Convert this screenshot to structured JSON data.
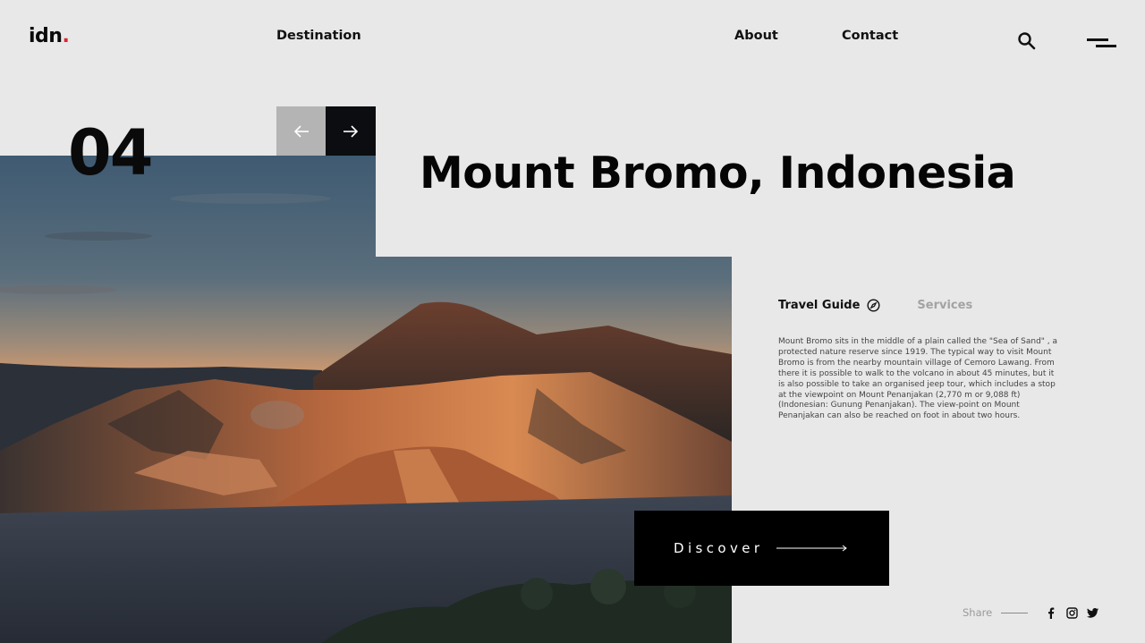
{
  "header": {
    "logo_text": "idn",
    "logo_dot": ".",
    "nav": {
      "destination": "Destination",
      "about": "About",
      "contact": "Contact"
    },
    "icons": {
      "search": "search-icon",
      "menu": "menu-icon"
    }
  },
  "slider": {
    "number": "04",
    "prev_icon": "arrow-left-icon",
    "next_icon": "arrow-right-icon"
  },
  "hero": {
    "title": "Mount Bromo, Indonesia"
  },
  "tabs": {
    "active": "Travel Guide",
    "active_icon": "compass-icon",
    "inactive": "Services"
  },
  "description": "Mount Bromo sits in the middle of a plain called the \"Sea of Sand\" , a protected nature reserve since 1919. The typical way to visit Mount Bromo is from the nearby mountain village of Cemoro Lawang. From there it is possible to walk to the volcano in about 45 minutes, but it is also possible to take an organised jeep tour, which includes a stop at the viewpoint on Mount Penanjakan (2,770 m or 9,088 ft) (Indonesian: Gunung Penanjakan). The view-point on Mount Penanjakan can also be reached on foot in about two hours.",
  "cta": {
    "label": "Discover"
  },
  "share": {
    "label": "Share",
    "icons": [
      "facebook-icon",
      "instagram-icon",
      "twitter-icon"
    ]
  },
  "colors": {
    "background": "#e8e8e8",
    "accent_dot": "#e3212e",
    "dark": "#0a0a0a",
    "muted": "#a3a3a3",
    "prev_button": "#b4b4b4"
  }
}
